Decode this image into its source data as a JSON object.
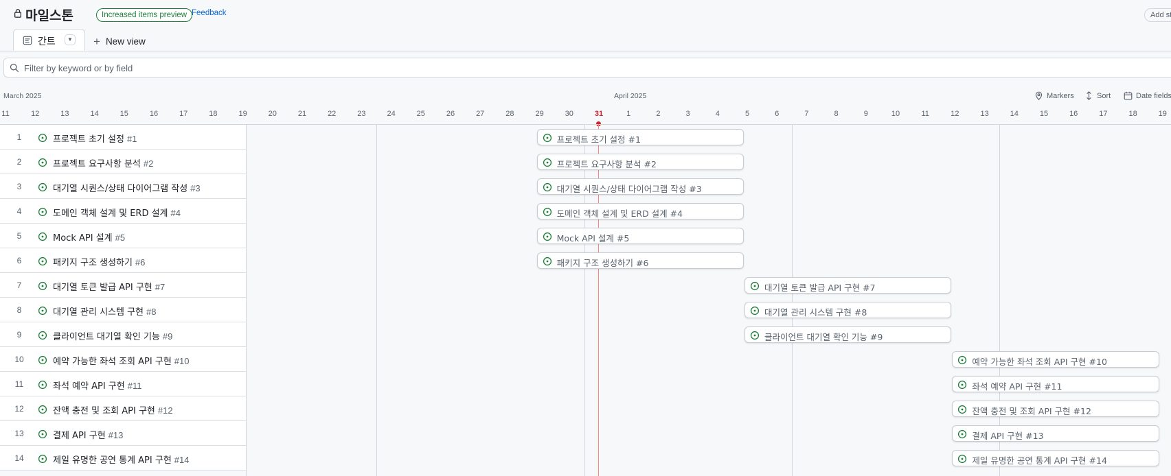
{
  "header": {
    "title": "마일스톤",
    "badge": "Increased items preview",
    "feedback": "Feedback",
    "add_status": "Add st"
  },
  "tabs": {
    "active_label": "간트",
    "new_view": "New view"
  },
  "filter": {
    "placeholder": "Filter by keyword or by field"
  },
  "timeline": {
    "month_left": "March 2025",
    "month_right": "April 2025",
    "today": "31",
    "days": [
      "11",
      "12",
      "13",
      "14",
      "15",
      "16",
      "17",
      "18",
      "19",
      "20",
      "21",
      "22",
      "23",
      "24",
      "25",
      "26",
      "27",
      "28",
      "29",
      "30",
      "31",
      "1",
      "2",
      "3",
      "4",
      "5",
      "6",
      "7",
      "8",
      "9",
      "10",
      "11",
      "12",
      "13",
      "14",
      "15",
      "16",
      "17",
      "18",
      "19"
    ],
    "toolbar": {
      "markers": "Markers",
      "sort": "Sort",
      "date_fields": "Date fields"
    }
  },
  "items": [
    {
      "num": "1",
      "title": "프로젝트 초기 설정",
      "ref": "#1",
      "start": "2025-03-29",
      "end": "2025-04-04"
    },
    {
      "num": "2",
      "title": "프로젝트 요구사항 분석",
      "ref": "#2",
      "start": "2025-03-29",
      "end": "2025-04-04"
    },
    {
      "num": "3",
      "title": "대기열 시퀀스/상태 다이어그램 작성",
      "ref": "#3",
      "start": "2025-03-29",
      "end": "2025-04-04"
    },
    {
      "num": "4",
      "title": "도메인 객체 설계 및 ERD 설계",
      "ref": "#4",
      "start": "2025-03-29",
      "end": "2025-04-04"
    },
    {
      "num": "5",
      "title": "Mock API 설계",
      "ref": "#5",
      "start": "2025-03-29",
      "end": "2025-04-04"
    },
    {
      "num": "6",
      "title": "패키지 구조 생성하기",
      "ref": "#6",
      "start": "2025-03-29",
      "end": "2025-04-04"
    },
    {
      "num": "7",
      "title": "대기열 토큰 발급 API 구현",
      "ref": "#7",
      "start": "2025-04-05",
      "end": "2025-04-11"
    },
    {
      "num": "8",
      "title": "대기열 관리 시스템 구현",
      "ref": "#8",
      "start": "2025-04-05",
      "end": "2025-04-11"
    },
    {
      "num": "9",
      "title": "클라이언트 대기열 확인 기능",
      "ref": "#9",
      "start": "2025-04-05",
      "end": "2025-04-11"
    },
    {
      "num": "10",
      "title": "예약 가능한 좌석 조회 API 구현",
      "ref": "#10",
      "start": "2025-04-12",
      "end": "2025-04-18"
    },
    {
      "num": "11",
      "title": "좌석 예약 API 구현",
      "ref": "#11",
      "start": "2025-04-12",
      "end": "2025-04-18"
    },
    {
      "num": "12",
      "title": "잔액 충전 및 조회 API 구현",
      "ref": "#12",
      "start": "2025-04-12",
      "end": "2025-04-18"
    },
    {
      "num": "13",
      "title": "결제 API 구현",
      "ref": "#13",
      "start": "2025-04-12",
      "end": "2025-04-18"
    },
    {
      "num": "14",
      "title": "제일 유명한 공연 통계 API 구현",
      "ref": "#14",
      "start": "2025-04-12",
      "end": "2025-04-18"
    }
  ],
  "colors": {
    "open_issue": "#1a7f37",
    "today_marker": "#cf222e",
    "link": "#0969da"
  }
}
